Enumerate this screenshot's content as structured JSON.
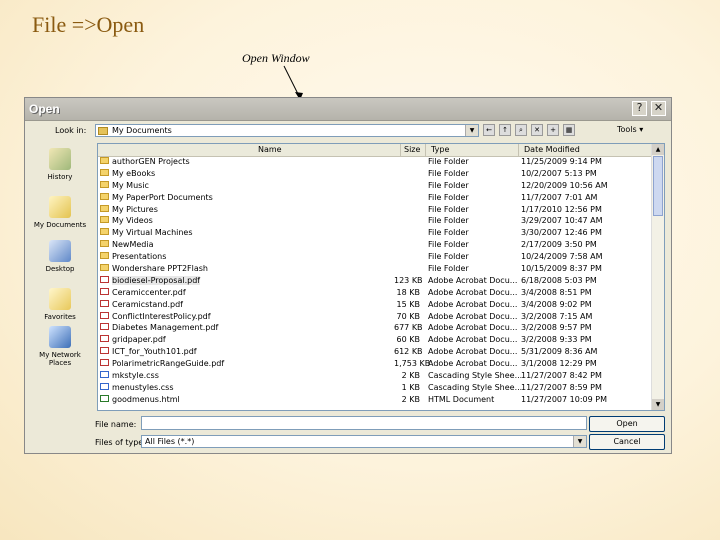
{
  "slide": {
    "title": "File =>Open",
    "callout": "Open Window"
  },
  "dialog": {
    "title": "Open",
    "help_glyph": "?",
    "close_glyph": "✕",
    "look_in_label": "Look in:",
    "look_in_value": "My Documents",
    "tools_label": "Tools ▾",
    "places": [
      "History",
      "My Documents",
      "Desktop",
      "Favorites",
      "My Network Places"
    ],
    "columns": {
      "name": "Name",
      "size": "Size",
      "type": "Type",
      "date": "Date Modified"
    },
    "files": [
      {
        "icon": "folder",
        "name": "authorGEN Projects",
        "size": "",
        "type": "File Folder",
        "date": "11/25/2009 9:14 PM"
      },
      {
        "icon": "folder",
        "name": "My eBooks",
        "size": "",
        "type": "File Folder",
        "date": "10/2/2007 5:13 PM"
      },
      {
        "icon": "folder",
        "name": "My Music",
        "size": "",
        "type": "File Folder",
        "date": "12/20/2009 10:56 AM"
      },
      {
        "icon": "folder",
        "name": "My PaperPort Documents",
        "size": "",
        "type": "File Folder",
        "date": "11/7/2007 7:01 AM"
      },
      {
        "icon": "folder",
        "name": "My Pictures",
        "size": "",
        "type": "File Folder",
        "date": "1/17/2010 12:56 PM"
      },
      {
        "icon": "folder",
        "name": "My Videos",
        "size": "",
        "type": "File Folder",
        "date": "3/29/2007 10:47 AM"
      },
      {
        "icon": "folder",
        "name": "My Virtual Machines",
        "size": "",
        "type": "File Folder",
        "date": "3/30/2007 12:46 PM"
      },
      {
        "icon": "folder",
        "name": "NewMedia",
        "size": "",
        "type": "File Folder",
        "date": "2/17/2009 3:50 PM"
      },
      {
        "icon": "folder",
        "name": "Presentations",
        "size": "",
        "type": "File Folder",
        "date": "10/24/2009 7:58 AM"
      },
      {
        "icon": "folder",
        "name": "Wondershare PPT2Flash",
        "size": "",
        "type": "File Folder",
        "date": "10/15/2009 8:37 PM"
      },
      {
        "icon": "pdf",
        "name": "biodiesel-Proposal.pdf",
        "size": "123 KB",
        "type": "Adobe Acrobat Docu...",
        "date": "6/18/2008 5:03 PM"
      },
      {
        "icon": "pdf",
        "name": "Ceramiccenter.pdf",
        "size": "18 KB",
        "type": "Adobe Acrobat Docu...",
        "date": "3/4/2008 8:51 PM"
      },
      {
        "icon": "pdf",
        "name": "Ceramicstand.pdf",
        "size": "15 KB",
        "type": "Adobe Acrobat Docu...",
        "date": "3/4/2008 9:02 PM"
      },
      {
        "icon": "pdf",
        "name": "ConflictInterestPolicy.pdf",
        "size": "70 KB",
        "type": "Adobe Acrobat Docu...",
        "date": "3/2/2008 7:15 AM"
      },
      {
        "icon": "pdf",
        "name": "Diabetes Management.pdf",
        "size": "677 KB",
        "type": "Adobe Acrobat Docu...",
        "date": "3/2/2008 9:57 PM"
      },
      {
        "icon": "pdf",
        "name": "gridpaper.pdf",
        "size": "60 KB",
        "type": "Adobe Acrobat Docu...",
        "date": "3/2/2008 9:33 PM"
      },
      {
        "icon": "pdf",
        "name": "ICT_for_Youth101.pdf",
        "size": "612 KB",
        "type": "Adobe Acrobat Docu...",
        "date": "5/31/2009 8:36 AM"
      },
      {
        "icon": "pdf",
        "name": "PolarimetricRangeGuide.pdf",
        "size": "1,753 KB",
        "type": "Adobe Acrobat Docu...",
        "date": "3/1/2008 12:29 PM"
      },
      {
        "icon": "css",
        "name": "mkstyle.css",
        "size": "2 KB",
        "type": "Cascading Style Shee...",
        "date": "11/27/2007 8:42 PM"
      },
      {
        "icon": "css",
        "name": "menustyles.css",
        "size": "1 KB",
        "type": "Cascading Style Shee...",
        "date": "11/27/2007 8:59 PM"
      },
      {
        "icon": "html",
        "name": "goodmenus.html",
        "size": "2 KB",
        "type": "HTML Document",
        "date": "11/27/2007 10:09 PM"
      }
    ],
    "file_name_label": "File name:",
    "file_name_value": "",
    "file_type_label": "Files of type:",
    "file_type_value": "All Files (*.*)",
    "open_button": "Open",
    "cancel_button": "Cancel"
  }
}
